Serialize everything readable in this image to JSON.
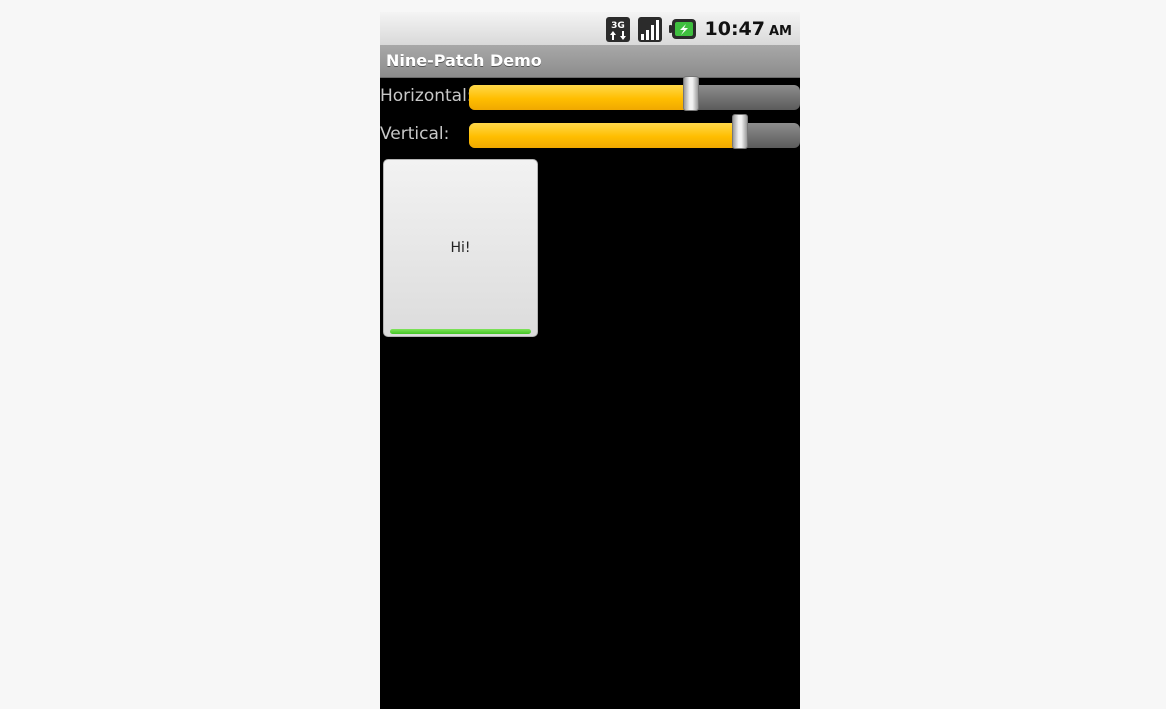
{
  "status_bar": {
    "network_icon": "3g-data-icon",
    "signal_icon": "signal-strength-icon",
    "battery_icon": "battery-charging-icon",
    "time": "10:47",
    "ampm": "AM"
  },
  "title_bar": {
    "title": "Nine-Patch Demo"
  },
  "controls": {
    "horizontal": {
      "label": "Horizontal:",
      "progress": 0.67
    },
    "vertical": {
      "label": "Vertical:",
      "progress": 0.82
    }
  },
  "demo_button": {
    "label": "Hi!",
    "accent_color": "#44c627"
  },
  "colors": {
    "seek_fill": "#ffbe00",
    "background": "#000000"
  }
}
